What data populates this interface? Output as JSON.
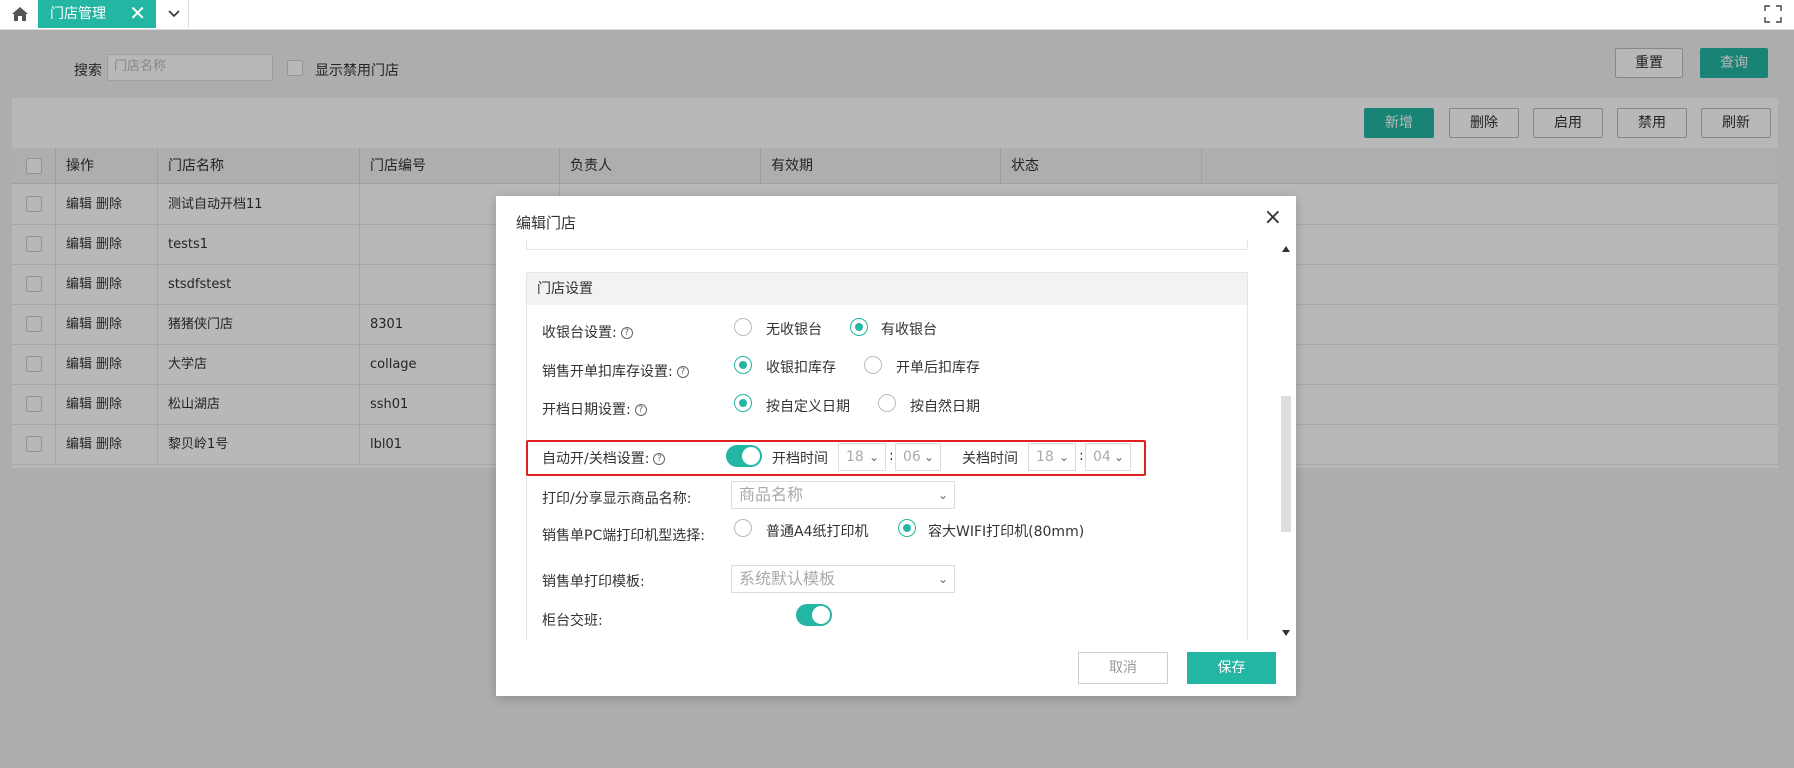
{
  "tab": {
    "label": "门店管理",
    "close": "✕"
  },
  "search": {
    "label": "搜索",
    "placeholder": "门店名称",
    "show_disabled": "显示禁用门店",
    "reset": "重置",
    "query": "查询"
  },
  "toolbar": {
    "add": "新增",
    "delete": "删除",
    "enable": "启用",
    "disable": "禁用",
    "refresh": "刷新"
  },
  "table": {
    "columns": [
      "操作",
      "门店名称",
      "门店编号",
      "负责人",
      "有效期",
      "状态"
    ],
    "edit": "编辑",
    "del": "删除",
    "rows": [
      {
        "name": "测试自动开档11",
        "code": ""
      },
      {
        "name": "tests1",
        "code": ""
      },
      {
        "name": "stsdfstest",
        "code": ""
      },
      {
        "name": "猪猪侠门店",
        "code": "8301"
      },
      {
        "name": "大学店",
        "code": "collage"
      },
      {
        "name": "松山湖店",
        "code": "ssh01"
      },
      {
        "name": "黎贝岭1号",
        "code": "lbl01"
      }
    ]
  },
  "modal": {
    "title": "编辑门店",
    "section": "门店设置",
    "cashier": {
      "label": "收银台设置:",
      "opt1": "无收银台",
      "opt2": "有收银台"
    },
    "stock": {
      "label": "销售开单扣库存设置:",
      "opt1": "收银扣库存",
      "opt2": "开单后扣库存"
    },
    "date": {
      "label": "开档日期设置:",
      "opt1": "按自定义日期",
      "opt2": "按自然日期"
    },
    "auto": {
      "label": "自动开/关档设置:",
      "open": "开档时间",
      "close": "关档时间",
      "oh": "18",
      "om": "06",
      "ch": "18",
      "cm": "04",
      "colon": ":"
    },
    "print_name": {
      "label": "打印/分享显示商品名称:",
      "value": "商品名称"
    },
    "printer": {
      "label": "销售单PC端打印机型选择:",
      "opt1": "普通A4纸打印机",
      "opt2": "容大WIFI打印机(80mm)"
    },
    "template": {
      "label": "销售单打印模板:",
      "value": "系统默认模板"
    },
    "shift": {
      "label": "柜台交班:"
    },
    "cancel": "取消",
    "save": "保存"
  }
}
